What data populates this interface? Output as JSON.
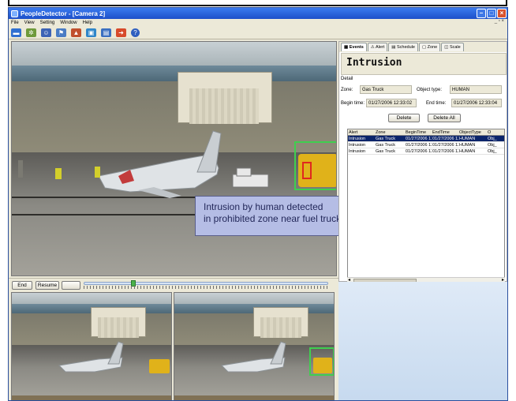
{
  "window": {
    "title": "PeopleDetector - [Camera 2]"
  },
  "menu": [
    "File",
    "View",
    "Setting",
    "Window",
    "Help"
  ],
  "callout": {
    "line1": "Intrusion by human detected",
    "line2": "in prohibited zone near fuel truck"
  },
  "tabs": [
    "Events",
    "Alert",
    "Schedule",
    "Zone",
    "Scale"
  ],
  "panel": {
    "title": "Intrusion",
    "detail_label": "Detail",
    "zone_label": "Zone:",
    "zone_value": "Gas Truck",
    "objtype_label": "Object type:",
    "objtype_value": "HUMAN",
    "begin_label": "Begin time:",
    "begin_value": "01/27/2006 12:33:02",
    "end_label": "End time:",
    "end_value": "01/27/2006 12:33:04",
    "delete_label": "Delete",
    "delete_all_label": "Delete All"
  },
  "grid": {
    "headers": [
      "Alert",
      "Zone",
      "BeginTime",
      "EndTime",
      "ObjectType",
      "O"
    ],
    "rows": [
      [
        "Intrusion",
        "Gas Truck",
        "01/27/2006 12",
        "01/27/2006 12",
        "HUMAN",
        "Obj_"
      ],
      [
        "Intrusion",
        "Gas Truck",
        "01/27/2006 12",
        "01/27/2006 12",
        "HUMAN",
        "Obj_"
      ],
      [
        "Intrusion",
        "Gas Truck",
        "01/27/2006 12",
        "01/27/2006 12",
        "HUMAN",
        "Obj_"
      ]
    ]
  },
  "playback": {
    "end_label": "End",
    "resume_label": "Resume"
  },
  "colors": {
    "zone_outline": "#3fcf4f",
    "human_box": "#e0281e",
    "callout_bg": "#b5bde5",
    "titlebar": "#1d4fc9"
  }
}
